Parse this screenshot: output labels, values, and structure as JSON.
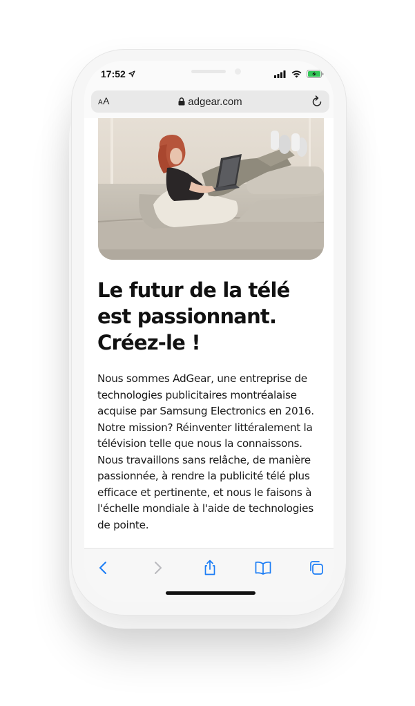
{
  "status_bar": {
    "time": "17:52",
    "icons": [
      "location-arrow-icon",
      "signal-icon",
      "wifi-icon",
      "battery-charging-icon"
    ]
  },
  "url_bar": {
    "text_size_label": "AA",
    "domain": "adgear.com",
    "icons": [
      "lock-icon",
      "reload-icon"
    ]
  },
  "hero_image": {
    "description_icon": "photo-woman-laptop-sofa"
  },
  "article": {
    "headline": "Le futur de la télé est passionnant. Créez-le !",
    "body": "Nous sommes AdGear, une entreprise de technologies publicitaires montréalaise acquise par Samsung Electronics en 2016. Notre mission? Réinventer littéralement la télévision telle que nous la connaissons. Nous travaillons sans relâche, de manière passionnée, à rendre la publicité télé plus efficace et pertinente, et nous le faisons à l'échelle mondiale à l'aide de technologies de pointe."
  },
  "toolbar": {
    "buttons": [
      "back-icon",
      "forward-icon",
      "share-icon",
      "bookmarks-icon",
      "tabs-icon"
    ]
  },
  "colors": {
    "accent": "#1a7cf5",
    "text": "#111111",
    "battery": "#34c759"
  }
}
